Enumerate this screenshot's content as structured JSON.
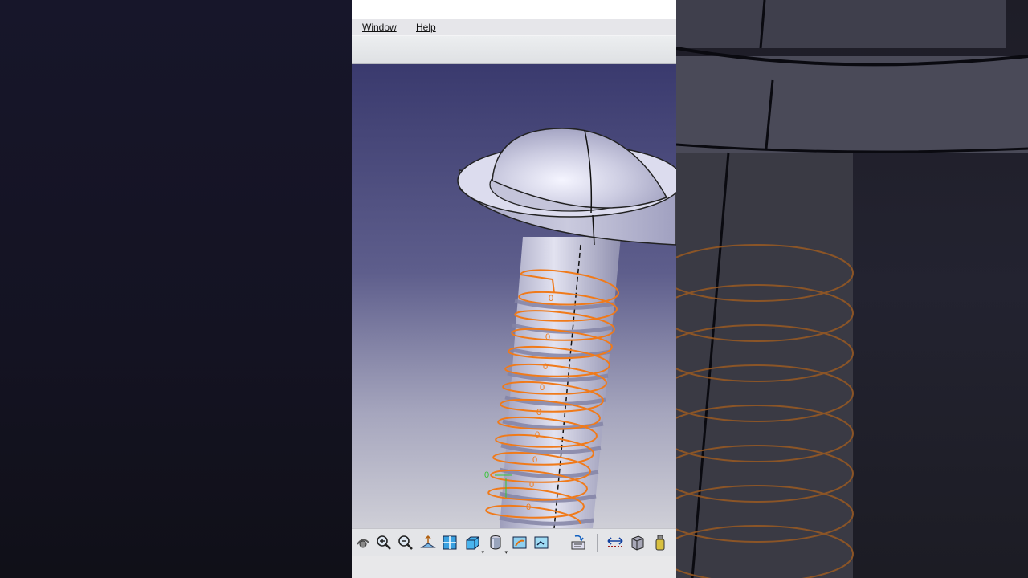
{
  "menubar": {
    "items": [
      {
        "label": "Window"
      },
      {
        "label": "Help"
      }
    ]
  },
  "viewport": {
    "model": "screw-with-helix-thread",
    "colors": {
      "background_top": "#3a3a6e",
      "background_bottom": "#c9c9d3",
      "part": "#c8c8dc",
      "helix": "#f07a1a",
      "axis_marker": "#36c436"
    }
  },
  "bottom_toolbar": {
    "icons": [
      "fly-mode-icon",
      "zoom-in-icon",
      "zoom-out-icon",
      "normal-view-icon",
      "multi-view-icon",
      "isometric-view-icon",
      "shading-icon",
      "hide-show-icon",
      "swap-visible-space-icon",
      "update-icon",
      "measure-between-icon",
      "measure-item-icon",
      "measure-inertia-icon"
    ]
  }
}
